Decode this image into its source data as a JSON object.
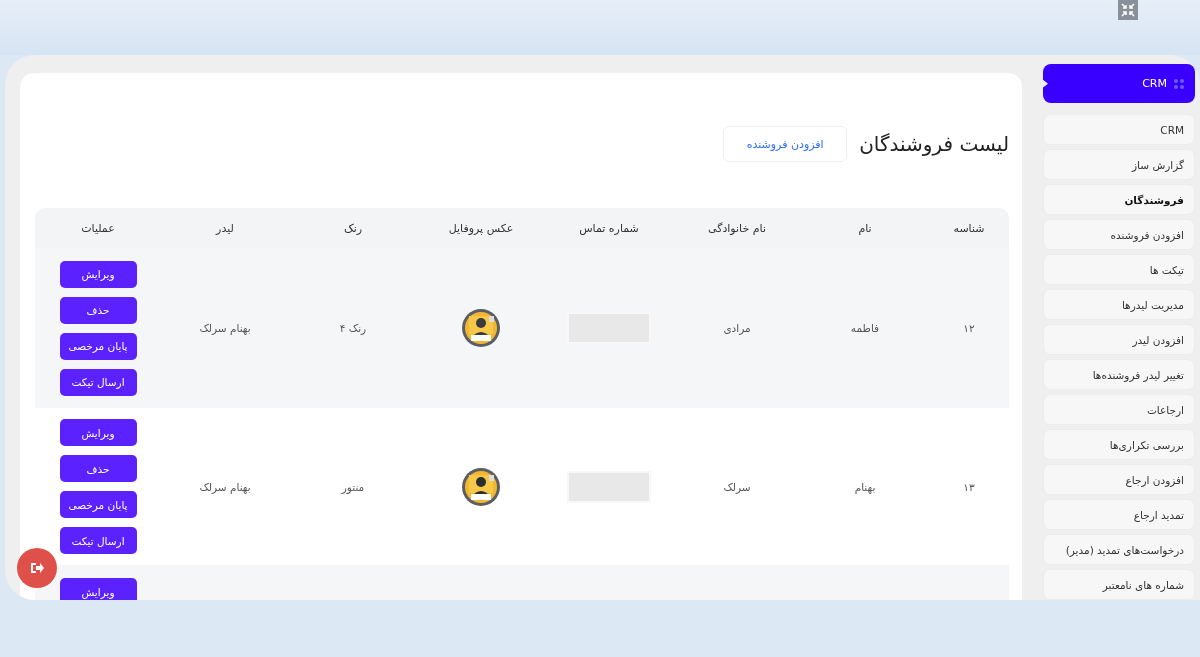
{
  "sidebar": {
    "header": "CRM",
    "items": [
      {
        "label": "CRM",
        "selected": false
      },
      {
        "label": "گزارش ساز",
        "selected": false
      },
      {
        "label": "فروشندگان",
        "selected": true
      },
      {
        "label": "افزودن فروشنده",
        "selected": false
      },
      {
        "label": "تیکت ها",
        "selected": false
      },
      {
        "label": "مدیریت لیدرها",
        "selected": false
      },
      {
        "label": "افزودن لیدر",
        "selected": false
      },
      {
        "label": "تغییر لیدر فروشنده‌ها",
        "selected": false
      },
      {
        "label": "ارجاعات",
        "selected": false
      },
      {
        "label": "بررسی تکراری‌ها",
        "selected": false
      },
      {
        "label": "افزودن ارجاع",
        "selected": false
      },
      {
        "label": "تمدید ارجاع",
        "selected": false
      },
      {
        "label": "درخواست‌های تمدید (مدیر)",
        "selected": false
      },
      {
        "label": "شماره های نامعتبر",
        "selected": false
      }
    ]
  },
  "page": {
    "title": "لیست فروشندگان",
    "add_button": "افزودن فروشنده"
  },
  "table": {
    "columns": [
      "شناسه",
      "نام",
      "نام خانوادگی",
      "شماره تماس",
      "عکس پروفایل",
      "رنک",
      "لیدر",
      "عملیات"
    ],
    "rows": [
      {
        "id": "۱۲",
        "first_name": "فاطمه",
        "last_name": "مرادی",
        "phone_redacted": true,
        "rank": "رنک ۴",
        "leader": "بهنام سرلک",
        "actions": [
          "ویرایش",
          "حذف",
          "پایان مرخصی",
          "ارسال تیکت"
        ]
      },
      {
        "id": "۱۳",
        "first_name": "بهنام",
        "last_name": "سرلک",
        "phone_redacted": true,
        "rank": "منتور",
        "leader": "بهنام سرلک",
        "actions": [
          "ویرایش",
          "حذف",
          "پایان مرخصی",
          "ارسال تیکت"
        ]
      },
      {
        "actions": [
          "ویرایش"
        ]
      }
    ]
  }
}
